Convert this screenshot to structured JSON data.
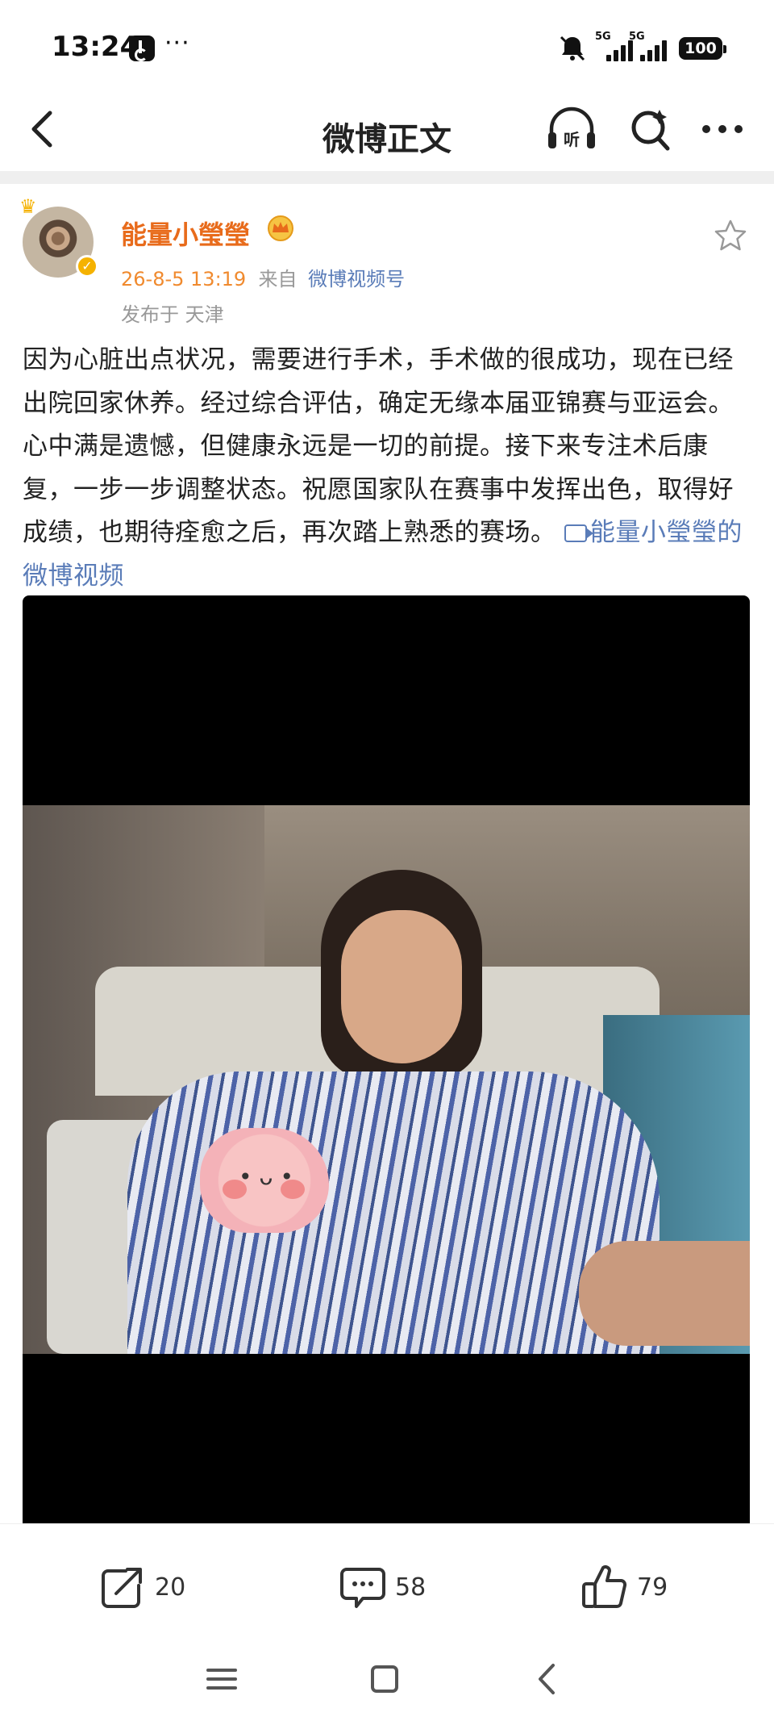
{
  "status_bar": {
    "time": "13:24",
    "app_icon": "douyin-icon",
    "more": "···",
    "signal_1_label": "5G",
    "signal_2_label": "5G",
    "battery": "100"
  },
  "title_bar": {
    "title": "微博正文",
    "listen_label": "听",
    "icons": [
      "back-icon",
      "listen-icon",
      "search-icon",
      "more-icon"
    ]
  },
  "post": {
    "username": "能量小瑩瑩",
    "date": "26-8-5 13:19",
    "from_label": "来自",
    "source": "微博视频号",
    "location": "发布于 天津",
    "text": "因为心脏出点状况，需要进行手术，手术做的很成功，现在已经出院回家休养。经过综合评估，确定无缘本届亚锦赛与亚运会。心中满是遗憾，但健康永远是一切的前提。接下来专注术后康复，一步一步调整状态。祝愿国家队在赛事中发挥出色，取得好成绩，也期待痊愈之后，再次踏上熟悉的赛场。",
    "video_link": "能量小瑩瑩的微博视频"
  },
  "actions": {
    "repost_count": "20",
    "comment_count": "58",
    "like_count": "79"
  },
  "colors": {
    "username": "#e86b1b",
    "link": "#5a7cb8",
    "date": "#f08a2e",
    "meta": "#999999"
  }
}
